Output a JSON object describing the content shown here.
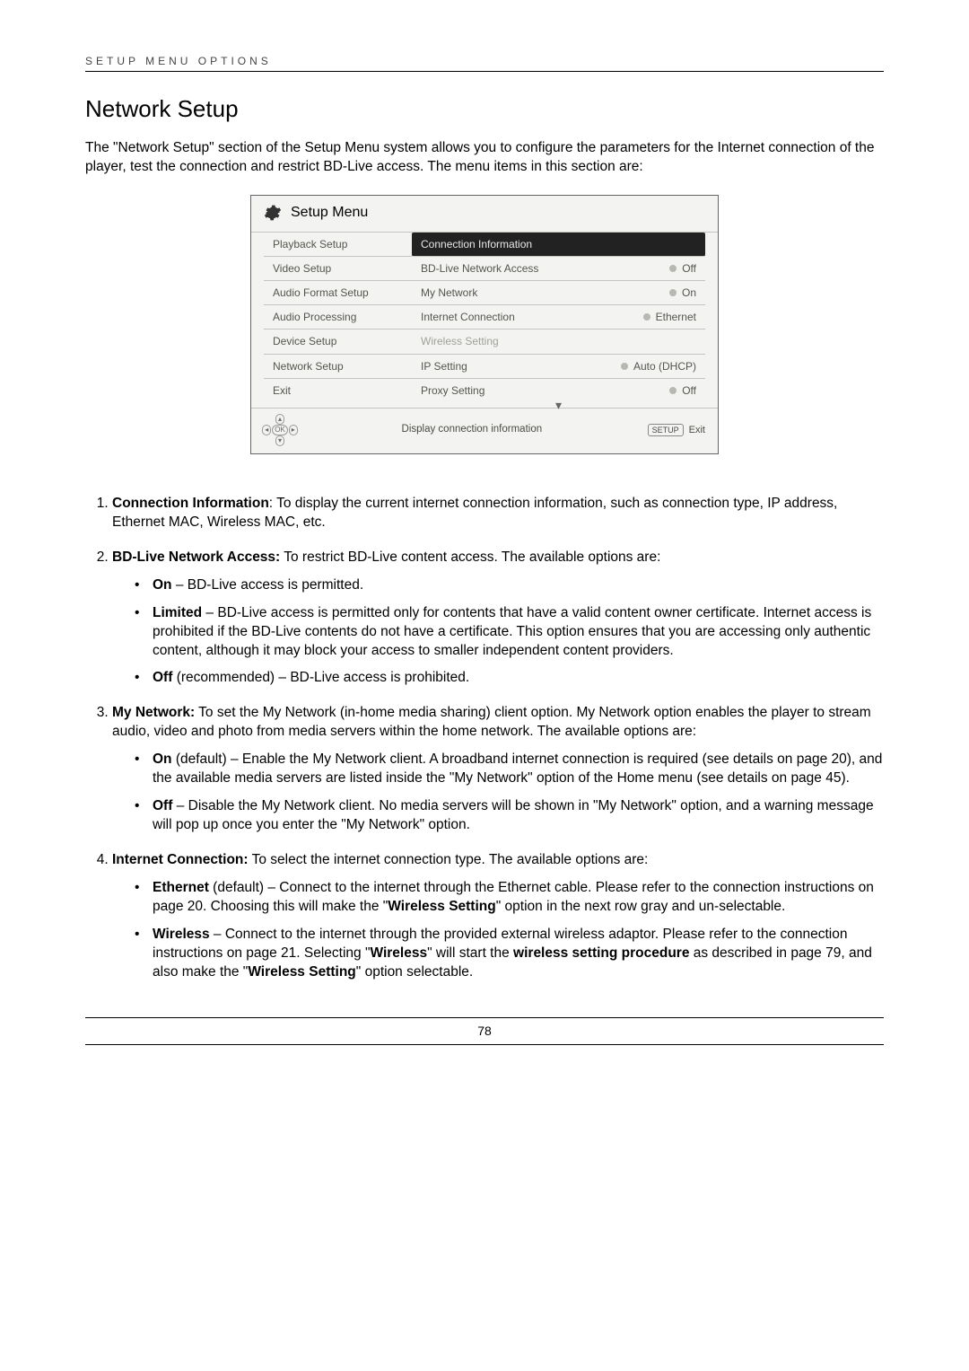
{
  "header_run": "SETUP MENU OPTIONS",
  "title": "Network Setup",
  "intro": "The \"Network Setup\" section of the Setup Menu system allows you to configure the parameters for the Internet connection of the player, test the connection and restrict BD-Live access. The menu items in this section are:",
  "setup_menu": {
    "header": "Setup Menu",
    "left": [
      "Playback Setup",
      "Video Setup",
      "Audio Format Setup",
      "Audio Processing",
      "Device Setup",
      "Network Setup",
      "Exit"
    ],
    "right": [
      {
        "label": "Connection Information",
        "value": "",
        "selected": true
      },
      {
        "label": "BD-Live Network Access",
        "value": "Off"
      },
      {
        "label": "My Network",
        "value": "On"
      },
      {
        "label": "Internet Connection",
        "value": "Ethernet"
      },
      {
        "label": "Wireless Setting",
        "value": "",
        "disabled": true
      },
      {
        "label": "IP Setting",
        "value": "Auto (DHCP)"
      },
      {
        "label": "Proxy Setting",
        "value": "Off"
      }
    ],
    "footer_text": "Display connection information",
    "footer_setup": "SETUP",
    "footer_exit": "Exit",
    "ok": "OK"
  },
  "items": {
    "i1": {
      "bold": "Connection Information",
      "rest": ": To display the current internet connection information, such as connection type, IP address, Ethernet MAC, Wireless MAC, etc."
    },
    "i2": {
      "bold": "BD-Live Network Access:",
      "rest": " To restrict BD-Live content access.  The available options are:",
      "b1": {
        "bold": "On",
        "rest": " – BD-Live access is permitted."
      },
      "b2": {
        "bold": "Limited",
        "rest": " – BD-Live access is permitted only for contents that have a valid content owner certificate.  Internet access is prohibited if the BD-Live contents do not have a certificate.  This option ensures that you are accessing only authentic content, although it may block your access to smaller independent content providers."
      },
      "b3": {
        "bold": "Off",
        "rest": " (recommended) – BD-Live access is prohibited."
      }
    },
    "i3": {
      "bold": "My Network:",
      "rest": " To set the My Network (in-home media sharing) client option.  My Network option enables the player to stream audio, video and photo from media servers within the home network.  The available options are:",
      "b1": {
        "bold": "On",
        "rest": " (default) – Enable the My Network client.  A broadband internet connection is required (see details on page 20), and the available media servers are listed inside the \"My Network\" option of the Home menu (see details on page 45)."
      },
      "b2": {
        "bold": "Off",
        "rest": " – Disable the My Network client.  No media servers will be shown in \"My Network\" option, and a warning message will pop up once you enter the \"My Network\" option."
      }
    },
    "i4": {
      "bold": "Internet Connection:",
      "rest": " To select the internet connection type.  The available options are:",
      "b1": {
        "bold": "Ethernet",
        "rest_a": " (default) – Connect to the internet through the Ethernet cable.  Please refer to the connection instructions on page 20. Choosing this will make the \"",
        "rest_bold": "Wireless Setting",
        "rest_b": "\" option in the next row gray and un-selectable."
      },
      "b2": {
        "bold": "Wireless",
        "rest_a": " – Connect to the internet through the provided external wireless adaptor.  Please refer to the connection instructions on page 21.  Selecting \"",
        "b2_bold1": "Wireless",
        "rest_b": "\" will start the ",
        "b2_bold2": "wireless setting procedure",
        "rest_c": " as described in page 79, and also make the \"",
        "b2_bold3": "Wireless Setting",
        "rest_d": "\" option selectable."
      }
    }
  },
  "page_number": "78"
}
